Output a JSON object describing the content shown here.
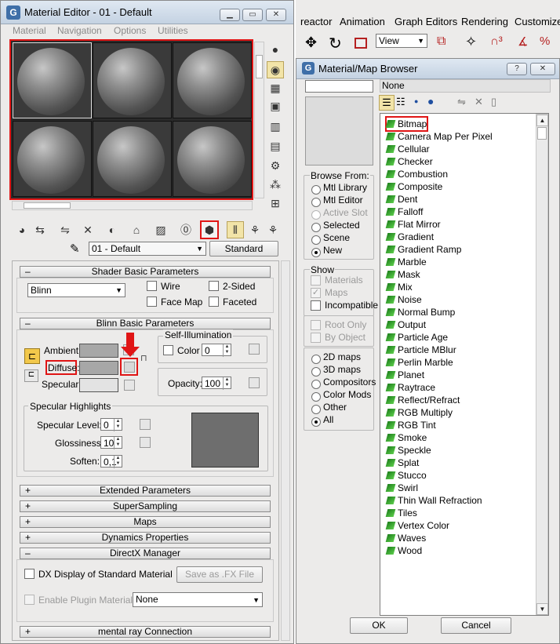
{
  "me": {
    "title": "Material Editor - 01 - Default",
    "menu": [
      "Material",
      "Navigation",
      "Options",
      "Utilities"
    ],
    "material_name": "01 - Default",
    "material_type": "Standard",
    "shader_rollout": "Shader Basic Parameters",
    "shader_value": "Blinn",
    "wire": "Wire",
    "two_sided": "2-Sided",
    "face_map": "Face Map",
    "faceted": "Faceted",
    "blinn_rollout": "Blinn Basic Parameters",
    "self_illum": "Self-Illumination",
    "color_label": "Color",
    "color_value": "0",
    "ambient": "Ambient:",
    "diffuse": "Diffuse:",
    "specular": "Specular:",
    "opacity_label": "Opacity:",
    "opacity_value": "100",
    "spec_highlights": "Specular Highlights",
    "spec_level": "Specular Level:",
    "spec_level_value": "0",
    "glossiness": "Glossiness:",
    "glossiness_value": "10",
    "soften": "Soften:",
    "soften_value": "0,1",
    "rollouts": [
      "Extended Parameters",
      "SuperSampling",
      "Maps",
      "Dynamics Properties",
      "DirectX Manager"
    ],
    "dx_display": "DX Display of Standard Material",
    "save_fx": "Save as .FX File",
    "enable_plugin": "Enable Plugin Material",
    "plugin_value": "None",
    "mental_ray": "mental ray Connection",
    "sign_minus": "–",
    "sign_plus": "+"
  },
  "main_menu": [
    "reactor",
    "Animation",
    "Graph Editors",
    "Rendering",
    "Customize"
  ],
  "view_value": "View",
  "mb": {
    "title": "Material/Map Browser",
    "name_value": "None",
    "browse_from": "Browse From:",
    "browse_items": [
      "Mtl Library",
      "Mtl Editor",
      "Active Slot",
      "Selected",
      "Scene",
      "New"
    ],
    "show": "Show",
    "show_items": [
      "Materials",
      "Maps",
      "Incompatible"
    ],
    "root_only": "Root Only",
    "by_object": "By Object",
    "filter_items": [
      "2D maps",
      "3D maps",
      "Compositors",
      "Color Mods",
      "Other",
      "All"
    ],
    "maps": [
      "Bitmap",
      "Camera Map Per Pixel",
      "Cellular",
      "Checker",
      "Combustion",
      "Composite",
      "Dent",
      "Falloff",
      "Flat Mirror",
      "Gradient",
      "Gradient Ramp",
      "Marble",
      "Mask",
      "Mix",
      "Noise",
      "Normal Bump",
      "Output",
      "Particle Age",
      "Particle MBlur",
      "Perlin Marble",
      "Planet",
      "Raytrace",
      "Reflect/Refract",
      "RGB Multiply",
      "RGB Tint",
      "Smoke",
      "Speckle",
      "Splat",
      "Stucco",
      "Swirl",
      "Thin Wall Refraction",
      "Tiles",
      "Vertex Color",
      "Waves",
      "Wood"
    ],
    "ok": "OK",
    "cancel": "Cancel",
    "help": "?",
    "close": "✕"
  },
  "icons": {
    "minimize": "▁",
    "restore": "▭",
    "close": "✕",
    "arrow": "⬇"
  }
}
